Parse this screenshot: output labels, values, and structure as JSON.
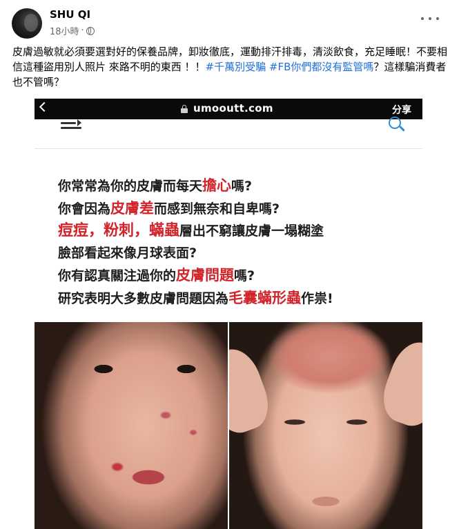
{
  "post": {
    "author": "SHU QI",
    "time": "18小時",
    "separator": "·",
    "text_before": "皮膚過敏就必須要選對好的保養品牌，卸妝徹底，運動排汗排毒，清淡飲食，充足睡眠！不要相信這種盜用別人照片 來路不明的東西 ！！",
    "hashtag_1": "#千萬別受騙",
    "hashtag_2": "#FB你們都沒有監管嗎",
    "text_after": "？這樣騙消費者也不管嗎？"
  },
  "screenshot": {
    "url": "umooutt.com",
    "share_label": "分享",
    "lines": [
      {
        "a": "你常常為你的皮膚而每天",
        "red": "擔心",
        "b": "嗎?"
      },
      {
        "a": "你會因為",
        "red": "皮膚差",
        "b": "而感到無奈和自卑嗎?"
      },
      {
        "red": "痘痘，粉刺，蟎蟲",
        "b": "層出不窮讓皮膚一塌糊塗"
      },
      {
        "a": "臉部看起來像月球表面?"
      },
      {
        "a": "你有認真關注過你的",
        "red": "皮膚問題",
        "b": "嗎?"
      },
      {
        "a": "研究表明大多數皮膚問題因為",
        "red": "毛囊蟎形蟲",
        "b": "作祟!"
      }
    ]
  },
  "colors": {
    "hashtag": "#216fdb",
    "accent_red": "#d1242b",
    "meta_gray": "#65676b"
  },
  "icons": [
    "globe-icon",
    "more-icon",
    "back-icon",
    "lock-icon",
    "menu-icon",
    "search-icon"
  ]
}
